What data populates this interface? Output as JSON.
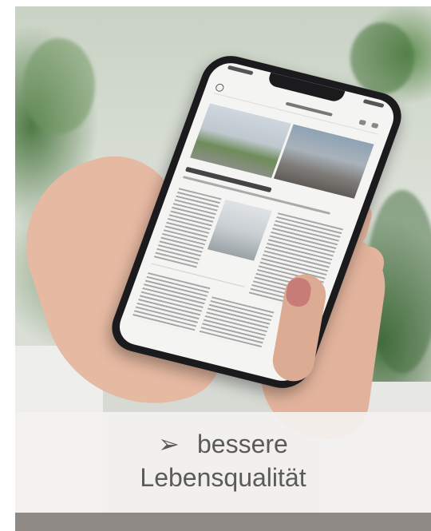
{
  "caption": {
    "bullet_glyph": "➢",
    "line1": "bessere",
    "line2": "Lebensqualität"
  },
  "colors": {
    "caption_text": "#5b5b5b",
    "banner_background": "#f4f2f0",
    "foliage_green": "#4f7a45"
  },
  "icons": [
    "arrow-bullet-icon"
  ]
}
